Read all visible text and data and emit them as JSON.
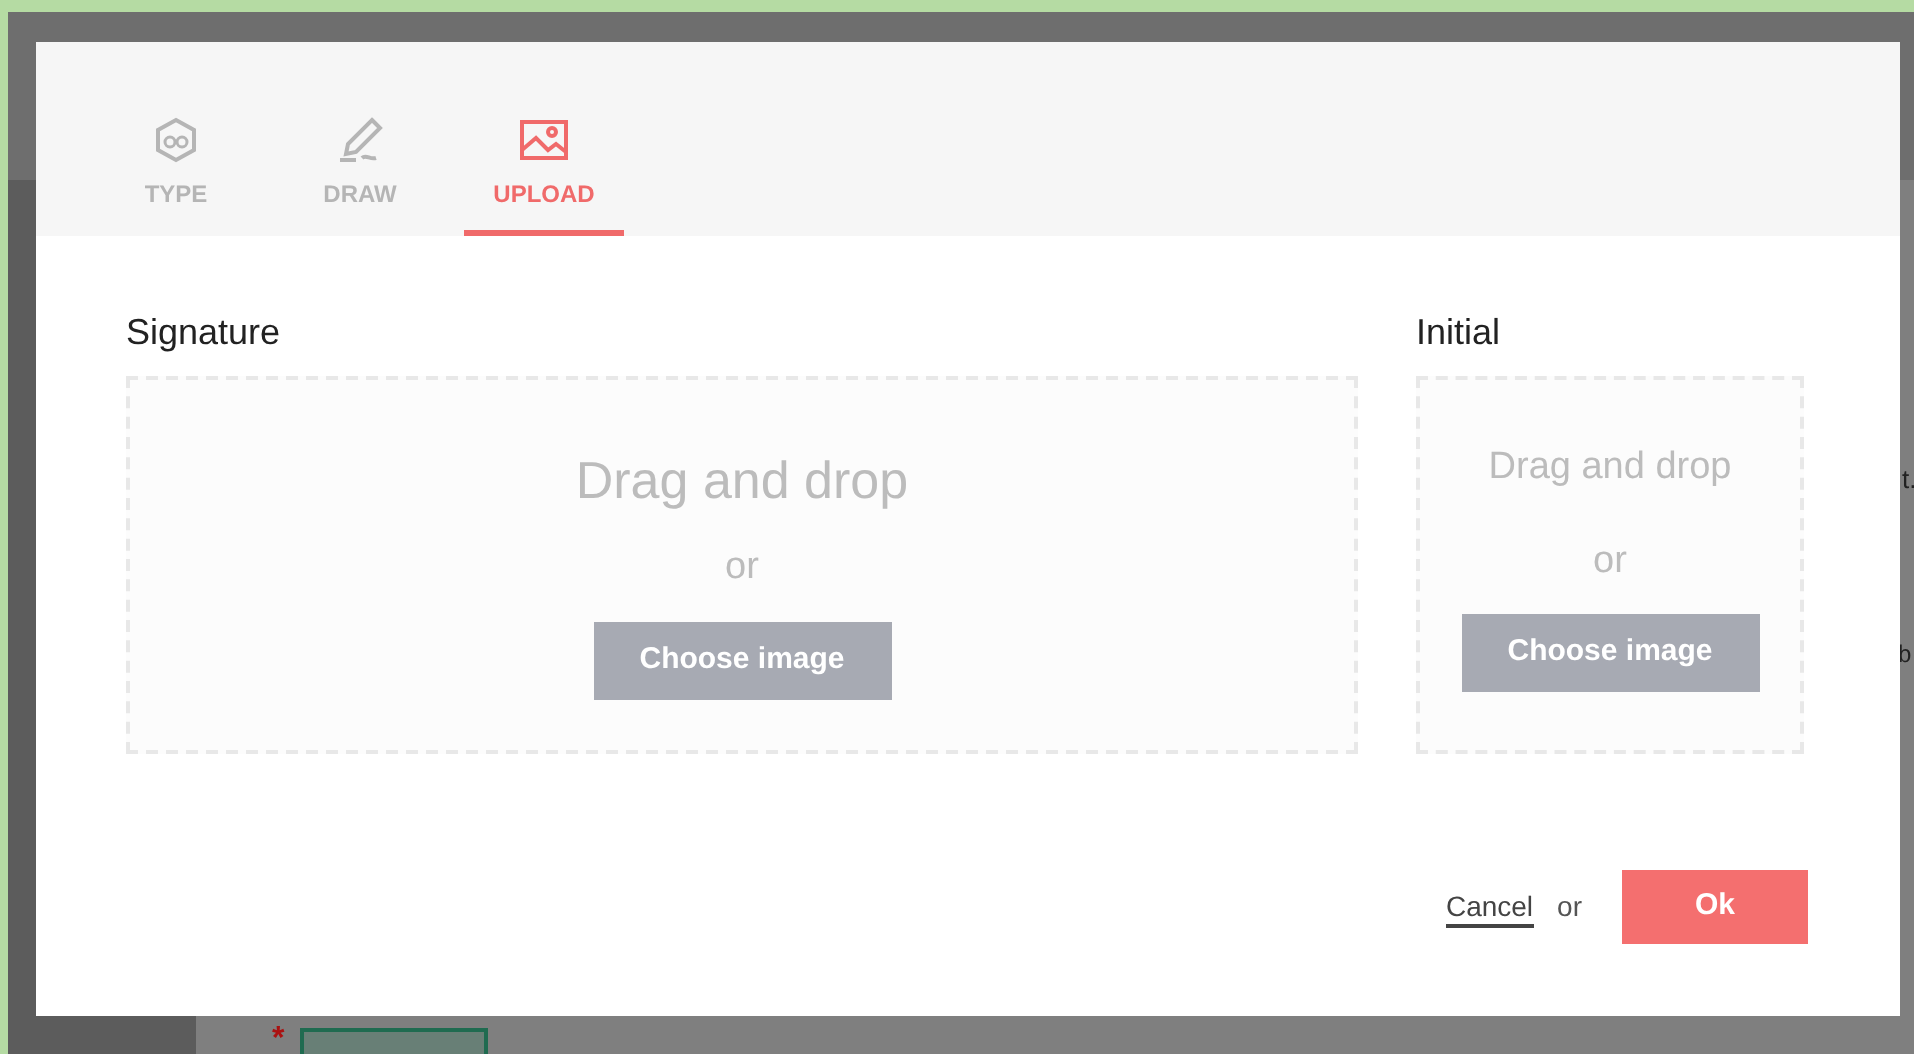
{
  "background": {
    "texts": [
      "t.",
      "b"
    ],
    "required_mark": "*"
  },
  "tabs": [
    {
      "label": "TYPE",
      "kind": "type",
      "selected": false
    },
    {
      "label": "DRAW",
      "kind": "draw",
      "selected": false
    },
    {
      "label": "UPLOAD",
      "kind": "upload",
      "selected": true
    }
  ],
  "panels": [
    {
      "title": "Signature",
      "kind": "large",
      "drop_text": "Drag and drop",
      "or": "or",
      "button": "Choose image"
    },
    {
      "title": "Initial",
      "kind": "small",
      "drop_text": "Drag and drop",
      "or": "or",
      "button": "Choose image"
    }
  ],
  "footer": {
    "cancel": "Cancel",
    "or": "or",
    "ok": "Ok"
  }
}
